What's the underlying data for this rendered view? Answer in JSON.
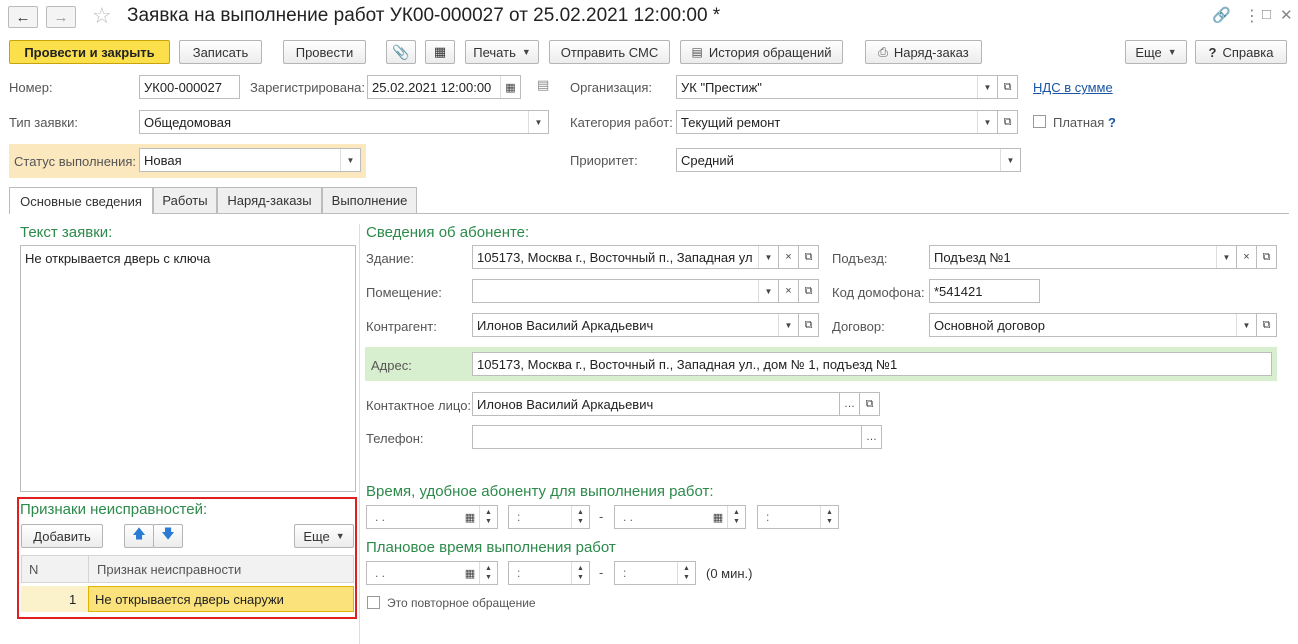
{
  "window": {
    "title": "Заявка на выполнение работ УК00-000027 от 25.02.2021 12:00:00 *"
  },
  "toolbar": {
    "post_close": "Провести и закрыть",
    "save": "Записать",
    "post": "Провести",
    "print": "Печать",
    "send_sms": "Отправить СМС",
    "history": "История обращений",
    "work_order": "Наряд-заказ",
    "more": "Еще",
    "help_mark": "?",
    "help": "Справка"
  },
  "header": {
    "number_label": "Номер:",
    "number_value": "УК00-000027",
    "registered_label": "Зарегистрирована:",
    "registered_value": "25.02.2021 12:00:00",
    "org_label": "Организация:",
    "org_value": "УК \"Престиж\"",
    "vat_link": "НДС в сумме",
    "type_label": "Тип заявки:",
    "type_value": "Общедомовая",
    "category_label": "Категория работ:",
    "category_value": "Текущий ремонт",
    "paid_label": "Платная",
    "paid_help": "?",
    "status_label": "Статус выполнения:",
    "status_value": "Новая",
    "priority_label": "Приоритет:",
    "priority_value": "Средний"
  },
  "tabs": [
    "Основные сведения",
    "Работы",
    "Наряд-заказы",
    "Выполнение"
  ],
  "request": {
    "heading": "Текст заявки:",
    "text": "Не открывается дверь с ключа"
  },
  "faults": {
    "heading": "Признаки неисправностей:",
    "add": "Добавить",
    "more": "Еще",
    "col_n": "N",
    "col_name": "Признак неисправности",
    "rows": [
      {
        "n": "1",
        "name": "Не открывается дверь снаружи"
      }
    ]
  },
  "subscriber": {
    "heading": "Сведения об абоненте:",
    "building_label": "Здание:",
    "building_value": "105173, Москва г., Восточный п., Западная ул",
    "entrance_label": "Подъезд:",
    "entrance_value": "Подъезд №1",
    "room_label": "Помещение:",
    "room_value": "",
    "intercom_label": "Код домофона:",
    "intercom_value": "*541421",
    "contractor_label": "Контрагент:",
    "contractor_value": "Илонов Василий Аркадьевич",
    "contract_label": "Договор:",
    "contract_value": "Основной договор",
    "address_label": "Адрес:",
    "address_value": "105173, Москва г., Восточный п., Западная ул., дом № 1, подъезд №1",
    "contact_label": "Контактное лицо:",
    "contact_value": "Илонов Василий Аркадьевич",
    "phone_label": "Телефон:",
    "phone_value": ""
  },
  "times": {
    "convenient_heading": "Время, удобное абоненту для выполнения работ:",
    "planned_heading": "Плановое время выполнения работ",
    "date_mask": " .  .",
    "time_mask": " :",
    "dash": "-",
    "duration": "(0 мин.)",
    "repeat_label": "Это повторное обращение"
  },
  "colors": {
    "accent_yellow": "#fbe04c",
    "status_highlight": "#fbe8bf",
    "address_highlight": "#d8efcf",
    "section_green": "#2c8a4a",
    "selection_red": "#e02020"
  }
}
